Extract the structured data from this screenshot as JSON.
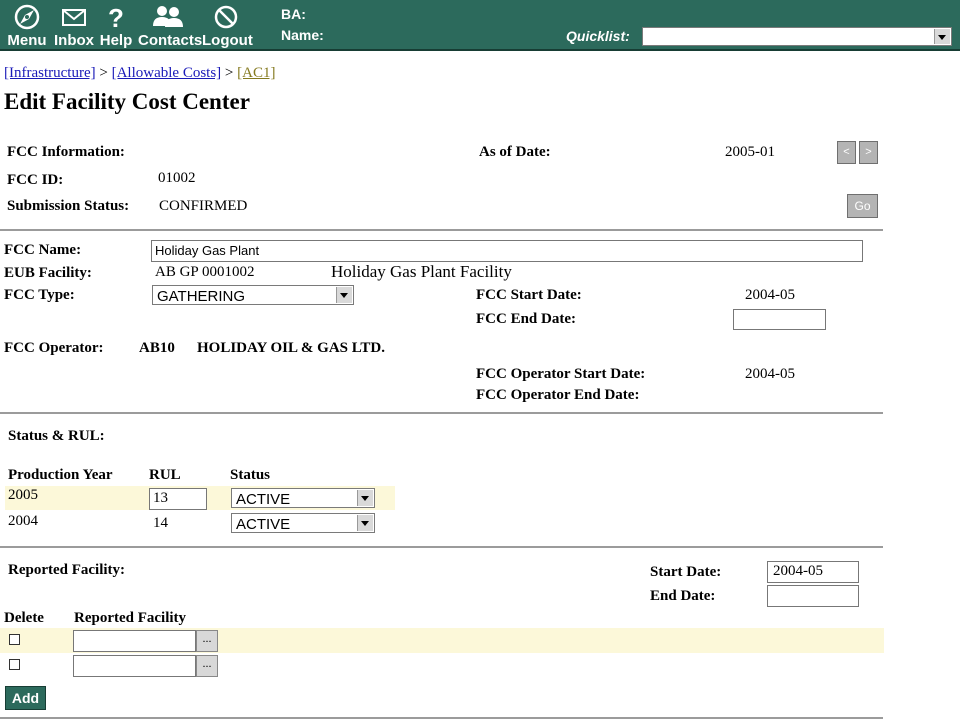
{
  "topbar": {
    "menu": "Menu",
    "inbox": "Inbox",
    "help": "Help",
    "contacts": "Contacts",
    "logout": "Logout",
    "ba_label": "BA:",
    "name_label": "Name:",
    "quicklist_label": "Quicklist:",
    "quicklist_value": ""
  },
  "breadcrumb": {
    "item1": "[Infrastructure]",
    "sep1": ">",
    "item2": "[Allowable Costs]",
    "sep2": ">",
    "item3": "[AC1]"
  },
  "page_title": "Edit Facility Cost Center",
  "fcc_info": {
    "info_label": "FCC Information:",
    "as_of_label": "As of Date:",
    "as_of_value": "2005-01",
    "prev_btn": "<",
    "next_btn": ">",
    "id_label": "FCC ID:",
    "id_value": "01002",
    "status_label": "Submission Status:",
    "status_value": "CONFIRMED",
    "go_btn": "Go"
  },
  "fcc_details": {
    "name_label": "FCC Name:",
    "name_value": "Holiday Gas Plant",
    "eub_label": "EUB Facility:",
    "eub_code": "AB GP 0001002",
    "eub_name": "Holiday Gas Plant Facility",
    "type_label": "FCC Type:",
    "type_value": "GATHERING",
    "start_label": "FCC Start Date:",
    "start_value": "2004-05",
    "end_label": "FCC End Date:",
    "end_value": "",
    "operator_label": "FCC Operator:",
    "operator_code": "AB10",
    "operator_name": "HOLIDAY OIL & GAS LTD.",
    "op_start_label": "FCC Operator Start Date:",
    "op_start_value": "2004-05",
    "op_end_label": "FCC Operator End Date:"
  },
  "status_rul": {
    "section_label": "Status & RUL:",
    "col_year": "Production Year",
    "col_rul": "RUL",
    "col_status": "Status",
    "rows": [
      {
        "year": "2005",
        "rul": "13",
        "status": "ACTIVE"
      },
      {
        "year": "2004",
        "rul": "14",
        "status": "ACTIVE"
      }
    ]
  },
  "reported": {
    "section_label": "Reported Facility:",
    "start_label": "Start Date:",
    "start_value": "2004-05",
    "end_label": "End Date:",
    "end_value": "",
    "col_delete": "Delete",
    "col_facility": "Reported Facility",
    "ellipsis": "...",
    "add_btn": "Add"
  },
  "colors": {
    "topbar": "#2c6a5c",
    "highlight_row": "#fcf8d9",
    "link": "#1a1ab8",
    "visited_link": "#857a1f"
  }
}
